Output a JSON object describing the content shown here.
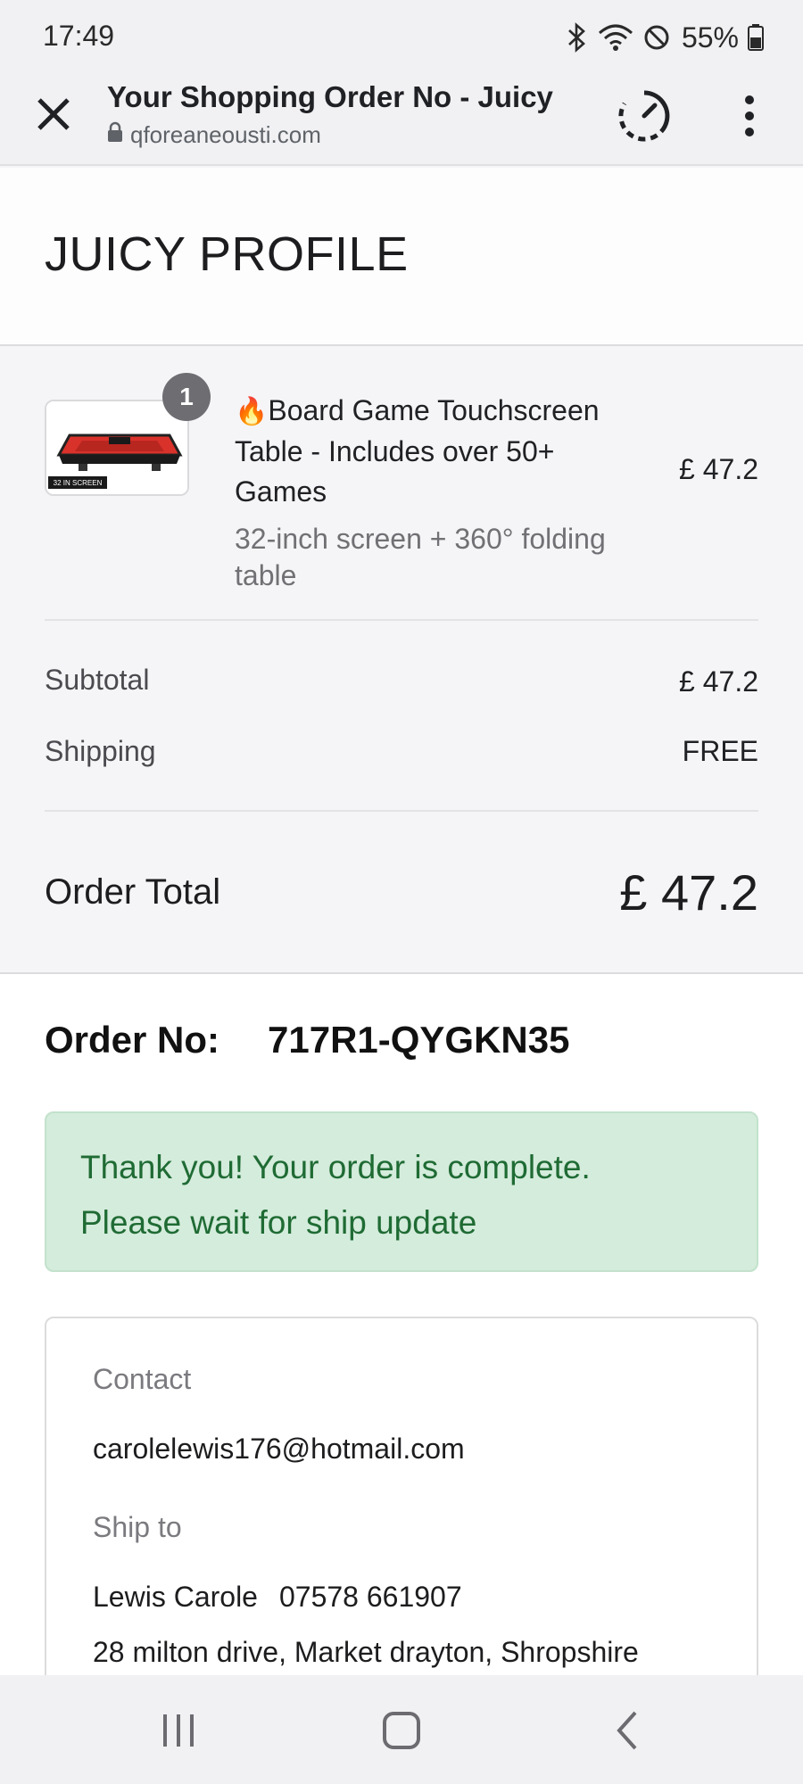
{
  "status_bar": {
    "time": "17:49",
    "battery": "55%",
    "icons": [
      "bluetooth-icon",
      "wifi-icon",
      "do-not-disturb-icon",
      "battery-icon"
    ]
  },
  "browser": {
    "title": "Your Shopping Order No - Juicy",
    "url": "qforeaneousti.com",
    "icons": [
      "close-icon",
      "lock-icon",
      "timer-icon",
      "more-vert-icon"
    ]
  },
  "shop": {
    "brand": "JUICY PROFILE"
  },
  "cart": {
    "item": {
      "quantity": "1",
      "emoji": "🔥",
      "name": "Board Game Touchscreen Table - Includes over 50+ Games",
      "variant": "32-inch screen + 360° folding table",
      "price": "£ 47.2",
      "thumb_caption": "32 IN SCREEN"
    },
    "subtotal_label": "Subtotal",
    "subtotal_value": "£ 47.2",
    "shipping_label": "Shipping",
    "shipping_value": "FREE",
    "total_label": "Order Total",
    "total_value": "£ 47.2"
  },
  "order": {
    "number_label": "Order No:",
    "number_value": "717R1-QYGKN35",
    "thanks_line1": "Thank you! Your order is complete.",
    "thanks_line2": "Please wait for ship update"
  },
  "customer": {
    "contact_label": "Contact",
    "email": "carolelewis176@hotmail.com",
    "ship_label": "Ship to",
    "name": "Lewis Carole",
    "phone": "07578 661907",
    "address": "28 milton drive, Market drayton, Shropshire"
  },
  "nav_bar": {
    "icons": [
      "recents-icon",
      "home-icon",
      "back-icon"
    ]
  },
  "colors": {
    "success_bg": "#d4ecdc",
    "success_text": "#1f6b34",
    "badge": "#6d6d72",
    "product_red": "#d9322b"
  }
}
